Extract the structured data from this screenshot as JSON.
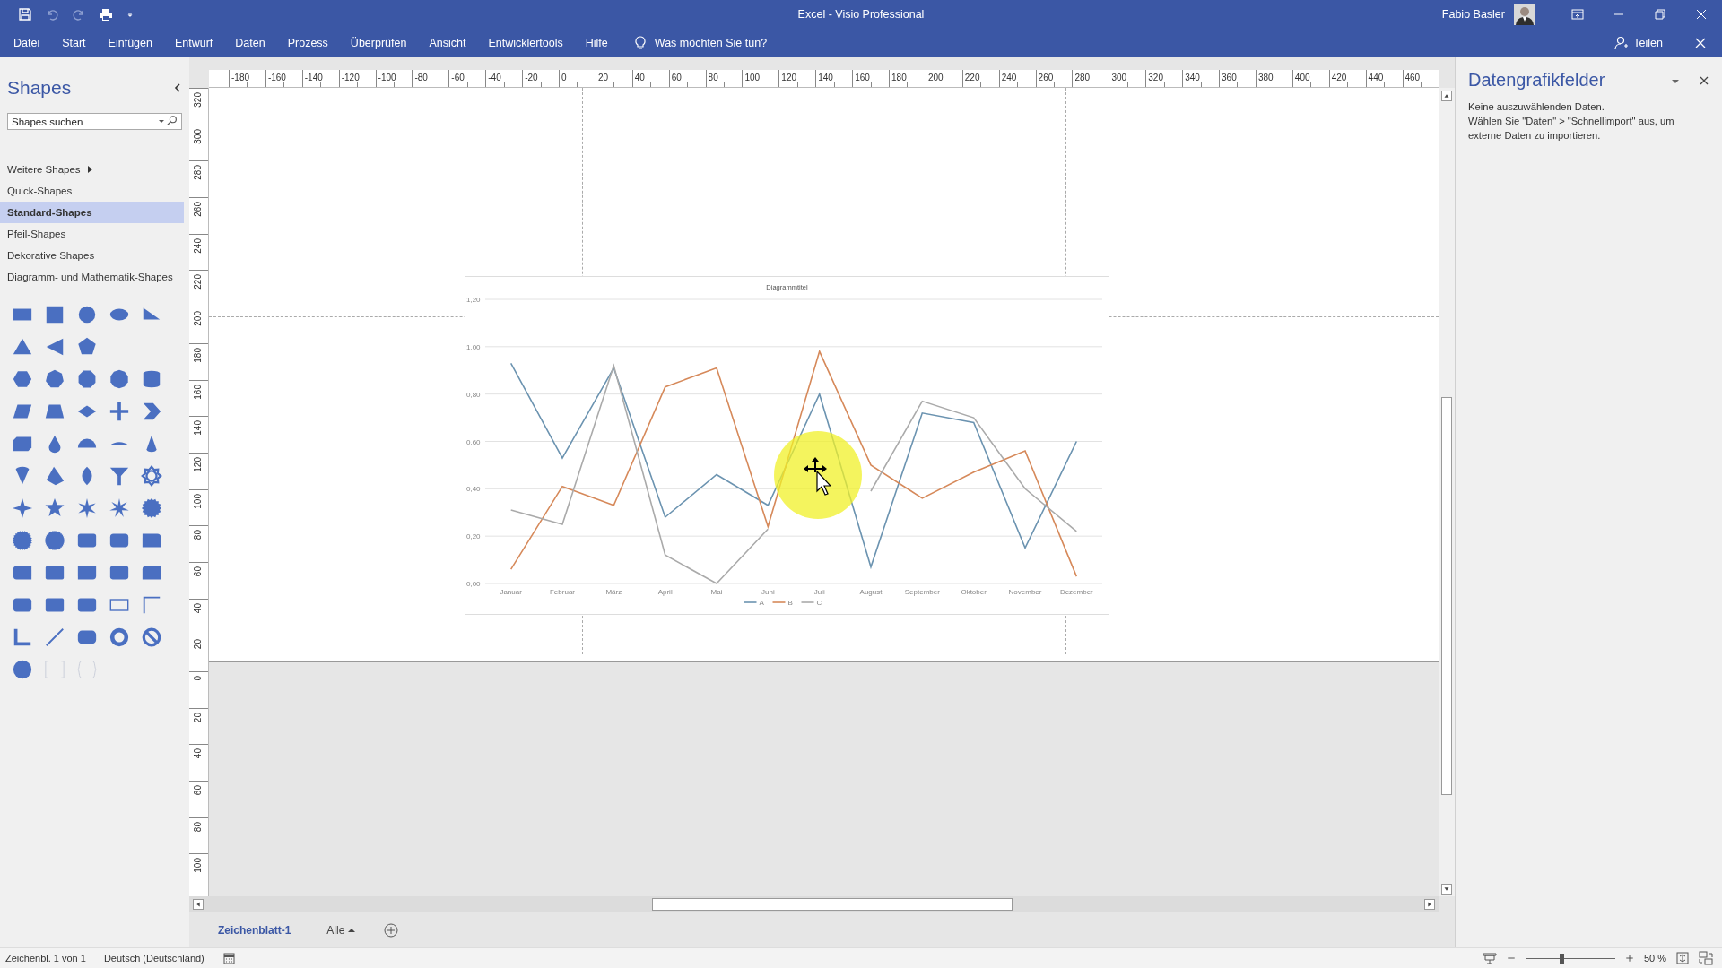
{
  "title_bar": {
    "title": "Excel  -  Visio Professional",
    "user": "Fabio Basler"
  },
  "ribbon": {
    "tabs": [
      {
        "label": "Datei",
        "selected": false
      },
      {
        "label": "Start",
        "selected": false
      },
      {
        "label": "Einfügen",
        "selected": false
      },
      {
        "label": "Entwurf",
        "selected": false
      },
      {
        "label": "Daten",
        "selected": false
      },
      {
        "label": "Prozess",
        "selected": false
      },
      {
        "label": "Überprüfen",
        "selected": false
      },
      {
        "label": "Ansicht",
        "selected": false
      },
      {
        "label": "Entwicklertools",
        "selected": false
      },
      {
        "label": "Hilfe",
        "selected": false
      }
    ],
    "tell_me": "Was möchten Sie tun?",
    "share": "Teilen"
  },
  "shapes_panel": {
    "title": "Shapes",
    "search": {
      "placeholder": "Shapes suchen"
    },
    "items": [
      {
        "label": "Weitere Shapes",
        "kind": "submenu",
        "selected": false
      },
      {
        "label": "Quick-Shapes",
        "kind": "stencil",
        "selected": false
      },
      {
        "label": "Standard-Shapes",
        "kind": "stencil",
        "selected": true
      },
      {
        "label": "Pfeil-Shapes",
        "kind": "stencil",
        "selected": false
      },
      {
        "label": "Dekorative Shapes",
        "kind": "stencil",
        "selected": false
      },
      {
        "label": "Diagramm- und Mathematik-Shapes",
        "kind": "stencil",
        "selected": false
      }
    ]
  },
  "ruler": {
    "horizontal": [
      "-180",
      "-160",
      "-140",
      "-120",
      "-100",
      "-80",
      "-60",
      "-40",
      "-20",
      "0",
      "20",
      "40",
      "60",
      "80",
      "100",
      "120",
      "140",
      "160",
      "180",
      "200",
      "220",
      "240",
      "260",
      "280",
      "300",
      "320",
      "340",
      "360",
      "380",
      "400",
      "420",
      "440",
      "460"
    ],
    "vertical": [
      "320",
      "300",
      "280",
      "260",
      "240",
      "220",
      "200",
      "180",
      "160",
      "140",
      "120",
      "100",
      "80",
      "60",
      "40",
      "20",
      "0",
      "20",
      "40",
      "60",
      "80",
      "100"
    ]
  },
  "chart": {
    "chart_data": {
      "type": "line",
      "title": "Diagrammtitel",
      "categories": [
        "Januar",
        "Februar",
        "März",
        "April",
        "Mai",
        "Juni",
        "Juli",
        "August",
        "September",
        "Oktober",
        "November",
        "Dezember"
      ],
      "series": [
        {
          "name": "A",
          "color": "#6b93b0",
          "values": [
            0.93,
            0.53,
            0.91,
            0.28,
            0.46,
            0.33,
            0.8,
            0.07,
            0.72,
            0.68,
            0.15,
            0.6
          ]
        },
        {
          "name": "B",
          "color": "#d6895a",
          "values": [
            0.06,
            0.41,
            0.33,
            0.83,
            0.91,
            0.24,
            0.98,
            0.5,
            0.36,
            0.47,
            0.56,
            0.03
          ]
        },
        {
          "name": "C",
          "color": "#aaaaaa",
          "values": [
            0.31,
            0.25,
            0.92,
            0.12,
            0.0,
            0.23,
            null,
            0.39,
            0.77,
            0.7,
            0.4,
            0.22
          ]
        }
      ],
      "ylim": [
        0,
        1.2
      ],
      "grid": true,
      "legend": "bottom",
      "yticks": [
        {
          "value": 0,
          "label": "0,00"
        },
        {
          "value": 0.2,
          "label": "0,20"
        },
        {
          "value": 0.4,
          "label": "0,40"
        },
        {
          "value": 0.6,
          "label": "0,60"
        },
        {
          "value": 0.8,
          "label": "0,80"
        },
        {
          "value": 1,
          "label": "1,00"
        },
        {
          "value": 1.2,
          "label": "1,20"
        }
      ]
    }
  },
  "sheet_tabs": {
    "tabs": [
      {
        "label": "Zeichenblatt-1",
        "selected": true
      }
    ],
    "all": "Alle"
  },
  "right_panel": {
    "title": "Datengrafikfelder",
    "message": "Keine auszuwählenden Daten.\nWählen Sie \"Daten\" > \"Schnellimport\" aus, um externe Daten zu importieren."
  },
  "status_bar": {
    "page": "Zeichenbl. 1 von 1",
    "language": "Deutsch (Deutschland)",
    "zoom": "50 %",
    "zoom_slider": {
      "level": 0.4
    }
  }
}
